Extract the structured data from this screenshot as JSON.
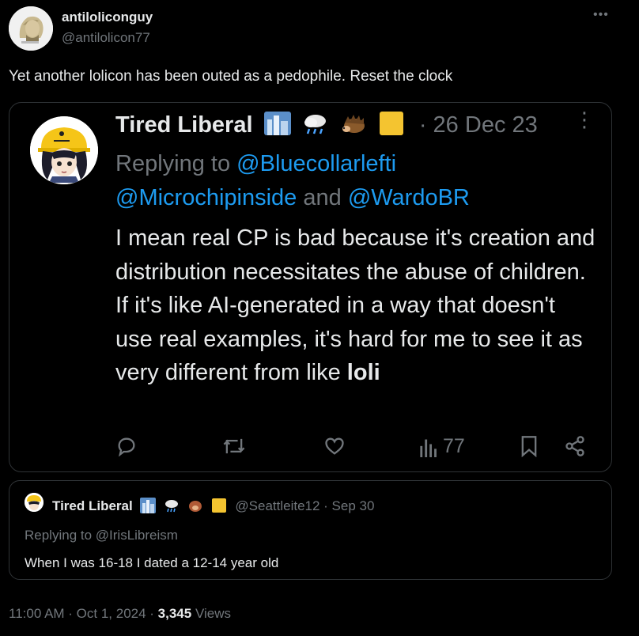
{
  "post": {
    "author_name": "antiloliconguy",
    "author_handle": "@antilolicon77",
    "text": "Yet another lolicon has been outed as a pedophile. Reset the clock",
    "more_icon": "more-dots-icon"
  },
  "quoted": {
    "author_name": "Tired Liberal",
    "date": "· 26 Dec 23",
    "replying_prefix": "Replying to",
    "mention1": "@Bluecollarlefti",
    "mention2": "@Microchipinside",
    "and_text": "and",
    "mention3": "@WardoBR",
    "body_main": "I mean real CP is bad because it's creation and distribution necessitates the abuse of children. If it's like AI-generated in a way that doesn't use real examples, it's hard for me to see it as very different from like",
    "body_bold": "loli",
    "views": "77",
    "emojis": [
      "cityscape",
      "cloud-with-rain",
      "hedgehog",
      "yellow-square"
    ]
  },
  "nested": {
    "author_name": "Tired Liberal",
    "handle_date": "@Seattleite12 · Sep 30",
    "replying": "Replying to @IrisLibreism",
    "body": "When I was 16-18 I dated a 12-14 year old"
  },
  "footer": {
    "time": "11:00 AM · Oct 1, 2024 · ",
    "views_count": "3,345",
    "views_label": " Views"
  },
  "colors": {
    "background": "#000000",
    "text": "#e7e9ea",
    "muted": "#71767b",
    "link": "#1d9bf0",
    "border": "#2f3336"
  }
}
